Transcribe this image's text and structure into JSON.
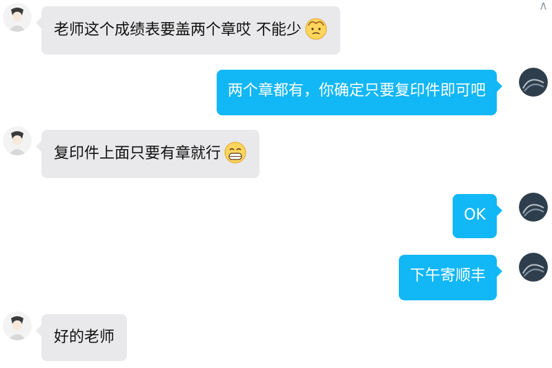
{
  "ui": {
    "scroll_icon": "chevron-up-icon",
    "scroll_glyph": "∧"
  },
  "colors": {
    "incoming_bubble": "#e9e9eb",
    "outgoing_bubble": "#12b7f5"
  },
  "messages": [
    {
      "side": "left",
      "text": "老师这个成绩表要盖两个章哎 不能少",
      "emoji": "old-man-face-icon"
    },
    {
      "side": "right",
      "text": "两个章都有，你确定只要复印件即可吧"
    },
    {
      "side": "left",
      "text": "复印件上面只要有章就行",
      "emoji": "grin-face-icon"
    },
    {
      "side": "right",
      "text": "OK"
    },
    {
      "side": "right",
      "text": "下午寄顺丰"
    },
    {
      "side": "left",
      "text": "好的老师"
    }
  ]
}
